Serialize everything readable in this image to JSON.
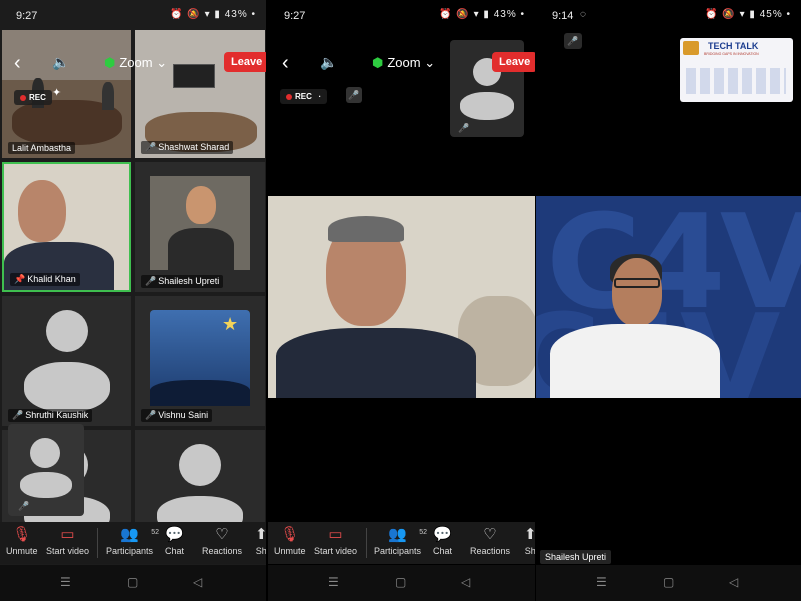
{
  "panel1": {
    "status": {
      "time": "9:27",
      "battery": "43%"
    },
    "zoom_label": "Zoom",
    "leave_label": "Leave",
    "rec_label": "REC",
    "tiles": [
      {
        "name": "Lalit Ambastha"
      },
      {
        "name": "Shashwat Sharad"
      },
      {
        "name": "Khalid Khan"
      },
      {
        "name": "Shailesh Upreti"
      },
      {
        "name": "Shruthi Kaushik"
      },
      {
        "name": "Vishnu Saini"
      }
    ],
    "toolbar": {
      "unmute": "Unmute",
      "start_video": "Start video",
      "participants": "Participants",
      "participants_count": "52",
      "chat": "Chat",
      "reactions": "Reactions",
      "share": "Sh"
    }
  },
  "panel2": {
    "status": {
      "time": "9:27",
      "battery": "43%"
    },
    "zoom_label": "Zoom",
    "leave_label": "Leave",
    "rec_label": "REC",
    "toolbar": {
      "unmute": "Unmute",
      "start_video": "Start video",
      "participants": "Participants",
      "participants_count": "52",
      "chat": "Chat",
      "reactions": "Reactions",
      "share": "Sh"
    }
  },
  "panel3": {
    "status": {
      "time": "9:14",
      "battery": "45%"
    },
    "speaker_name": "Shailesh Upreti",
    "banner_title": "TECH TALK",
    "banner_subtitle": "BRIDGING GAPS IN INNOVATION",
    "bg_letters": "C4V"
  },
  "colors": {
    "leave": "#e22d2d",
    "active_speaker_border": "#3fbf4f",
    "mic_off": "#e84d4d",
    "share_background": "#1e3a7a"
  }
}
